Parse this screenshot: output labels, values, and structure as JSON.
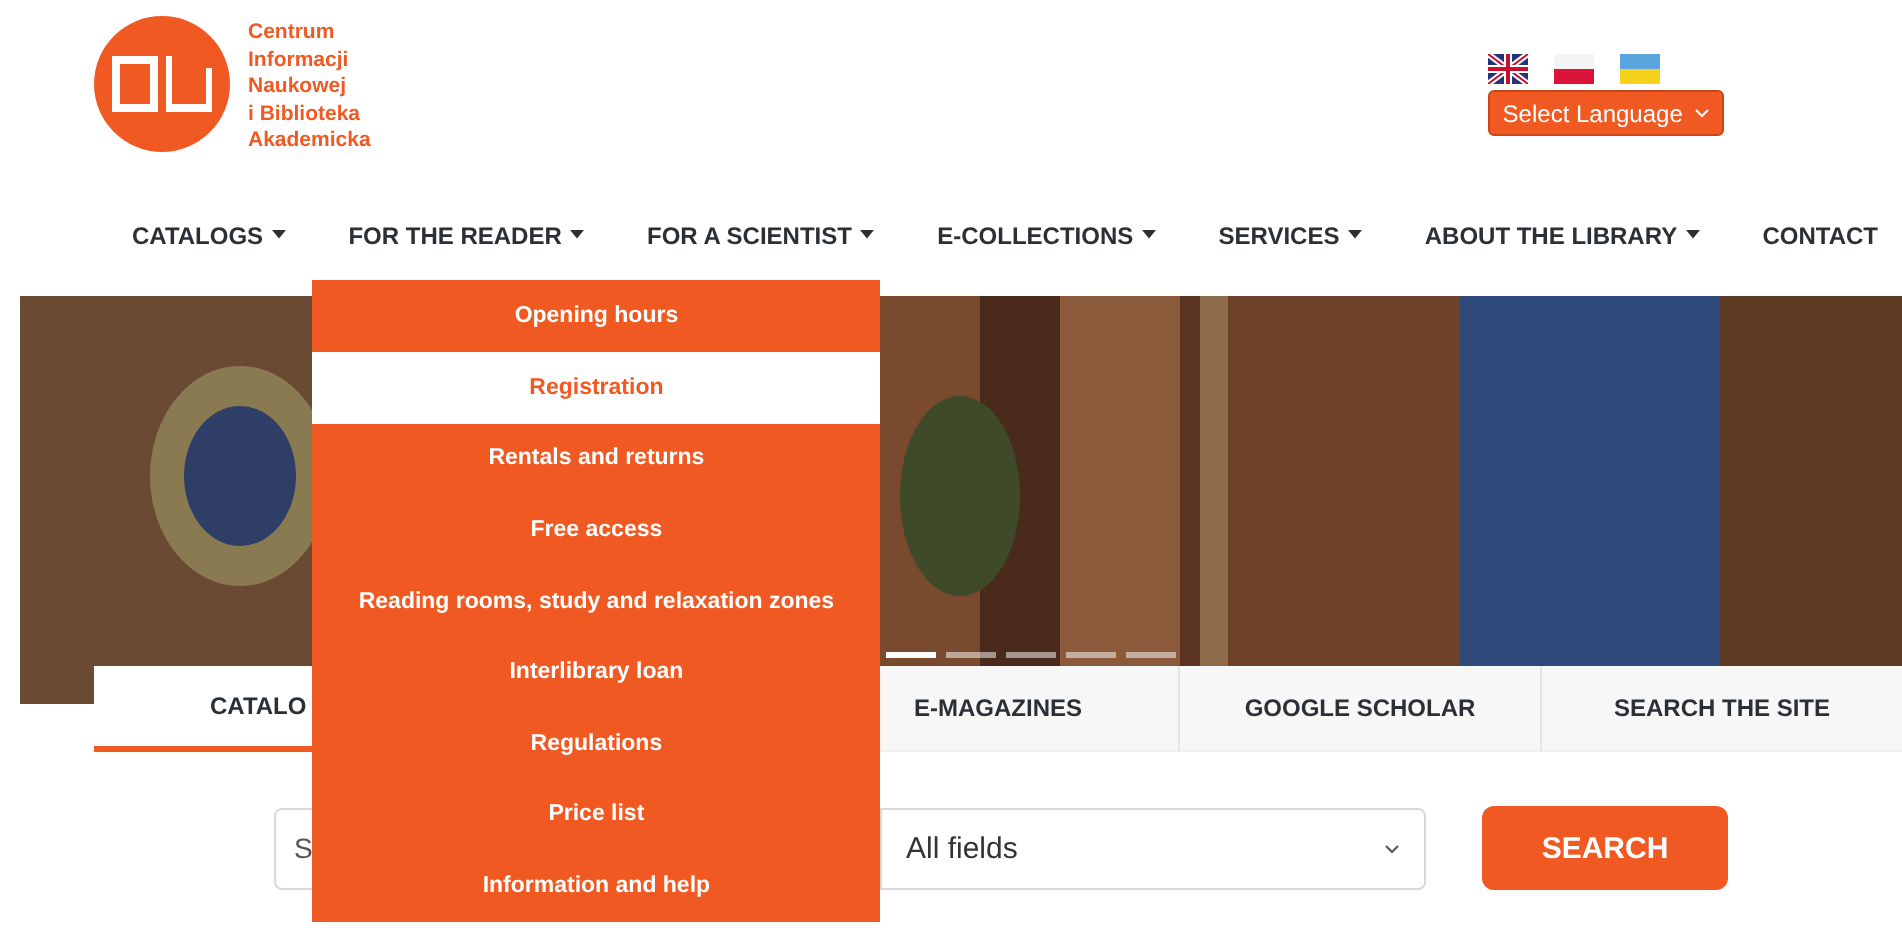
{
  "logo": {
    "text_lines": [
      "Centrum",
      "Informacji",
      "Naukowej",
      "i Biblioteka",
      "Akademicka"
    ]
  },
  "language_select": {
    "label": "Select Language"
  },
  "nav": [
    {
      "label": "CATALOGS",
      "dropdown": true,
      "expanded": false
    },
    {
      "label": "FOR THE READER",
      "dropdown": true,
      "expanded": true
    },
    {
      "label": "FOR A SCIENTIST",
      "dropdown": true,
      "expanded": false
    },
    {
      "label": "E-COLLECTIONS",
      "dropdown": true,
      "expanded": false
    },
    {
      "label": "SERVICES",
      "dropdown": true,
      "expanded": false
    },
    {
      "label": "ABOUT THE LIBRARY",
      "dropdown": true,
      "expanded": false
    },
    {
      "label": "CONTACT",
      "dropdown": false,
      "expanded": false
    }
  ],
  "dropdown_menu": {
    "items": [
      {
        "label": "Opening hours",
        "selected": false
      },
      {
        "label": "Registration",
        "selected": true
      },
      {
        "label": "Rentals and returns",
        "selected": false
      },
      {
        "label": "Free access",
        "selected": false
      },
      {
        "label": "Reading rooms, study and relaxation zones",
        "selected": false
      },
      {
        "label": "Interlibrary loan",
        "selected": false
      },
      {
        "label": "Regulations",
        "selected": false
      },
      {
        "label": "Price list",
        "selected": false
      },
      {
        "label": "Information and help",
        "selected": false
      }
    ]
  },
  "hero": {
    "kind": "picture",
    "slides": [
      {
        "selected": true
      },
      {
        "selected": false
      },
      {
        "selected": false
      },
      {
        "selected": false
      },
      {
        "selected": false
      }
    ]
  },
  "search_tabs": [
    {
      "label": "CATALO",
      "selected": true
    },
    {
      "label": "E-MAGAZINES",
      "selected": false
    },
    {
      "label": "GOOGLE SCHOLAR",
      "selected": false
    },
    {
      "label": "SEARCH THE SITE",
      "selected": false
    }
  ],
  "search_form": {
    "query": {
      "placeholder": "S"
    },
    "field_select": {
      "value": "All fields"
    },
    "submit": "SEARCH"
  }
}
